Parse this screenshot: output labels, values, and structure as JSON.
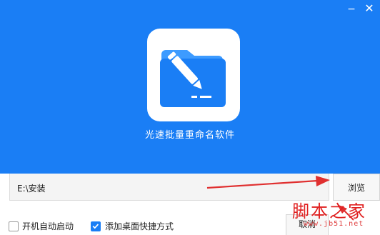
{
  "window": {
    "minimize_icon": "minimize-icon",
    "close_icon": "close-icon"
  },
  "header": {
    "background_color": "#1a7ef5",
    "app_icon": "folder-pencil-icon",
    "app_title": "光速批量重命名软件"
  },
  "path_field": {
    "value": "E:\\安装"
  },
  "browse_button": {
    "label": "浏览"
  },
  "options": [
    {
      "label": "开机自动启动",
      "checked": false
    },
    {
      "label": "添加桌面快捷方式",
      "checked": true
    }
  ],
  "cancel_button": {
    "label": "取消"
  },
  "watermark": {
    "text": "脚本之家",
    "url": "www.jb51.net"
  },
  "annotation": {
    "arrow_color": "#e03030"
  }
}
